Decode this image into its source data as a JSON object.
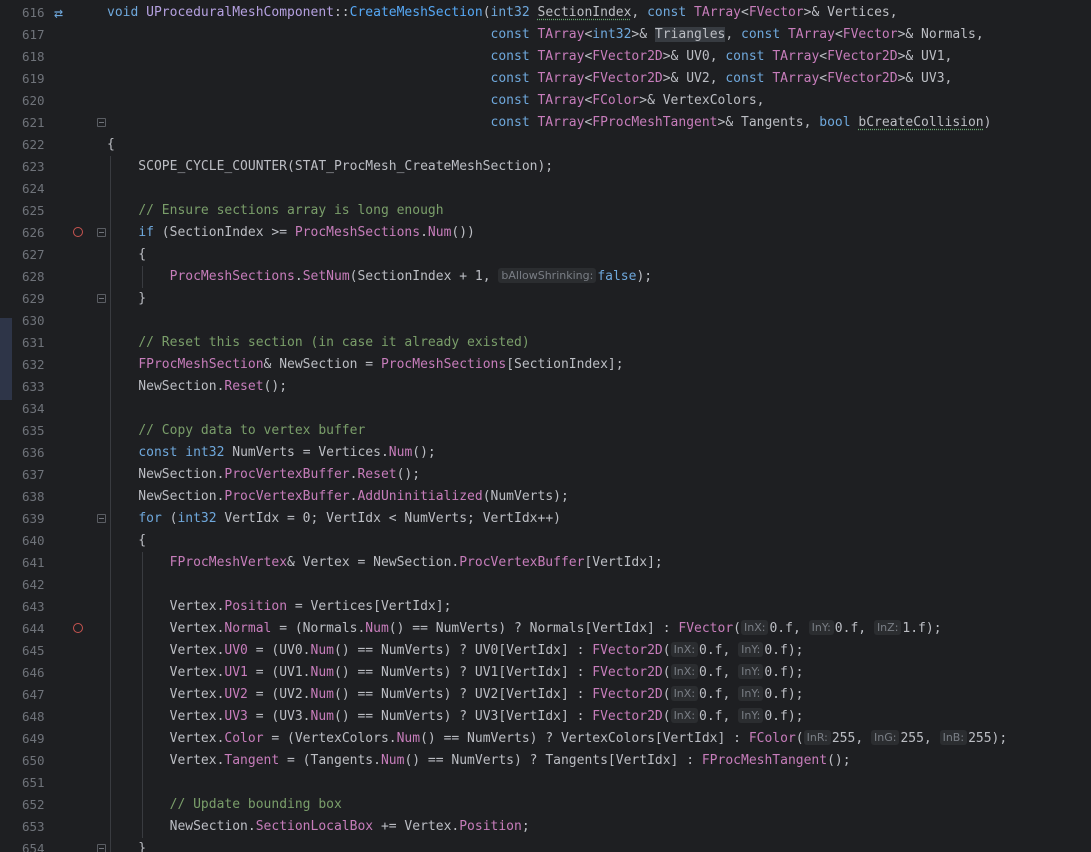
{
  "editor": {
    "lines": [
      {
        "n": "616",
        "icon": "swap",
        "fold": false,
        "bp": false,
        "indent": 0,
        "html": "<span class=\"keyw\">void</span> <span class=\"ty\">UProceduralMeshComponent</span>::<span class=\"fn\">CreateMeshSection</span>(<span class=\"keyw\">int32</span> <span class=\"squig\">SectionIndex</span>, <span class=\"keyw\">const</span> <span class=\"ty2\">TArray</span>&lt;<span class=\"ty2\">FVector</span>&gt;&amp; Vertices,"
      },
      {
        "n": "617",
        "icon": "",
        "fold": false,
        "bp": false,
        "indent": 0,
        "html": "                                                 <span class=\"keyw\">const</span> <span class=\"ty2\">TArray</span>&lt;<span class=\"keyw\">int32</span>&gt;&amp; <span class=\"hl\">Triangles</span>, <span class=\"keyw\">const</span> <span class=\"ty2\">TArray</span>&lt;<span class=\"ty2\">FVector</span>&gt;&amp; Normals,"
      },
      {
        "n": "618",
        "icon": "",
        "fold": false,
        "bp": false,
        "indent": 0,
        "html": "                                                 <span class=\"keyw\">const</span> <span class=\"ty2\">TArray</span>&lt;<span class=\"ty2\">FVector2D</span>&gt;&amp; UV0, <span class=\"keyw\">const</span> <span class=\"ty2\">TArray</span>&lt;<span class=\"ty2\">FVector2D</span>&gt;&amp; UV1,"
      },
      {
        "n": "619",
        "icon": "",
        "fold": false,
        "bp": false,
        "indent": 0,
        "html": "                                                 <span class=\"keyw\">const</span> <span class=\"ty2\">TArray</span>&lt;<span class=\"ty2\">FVector2D</span>&gt;&amp; UV2, <span class=\"keyw\">const</span> <span class=\"ty2\">TArray</span>&lt;<span class=\"ty2\">FVector2D</span>&gt;&amp; UV3,"
      },
      {
        "n": "620",
        "icon": "",
        "fold": false,
        "bp": false,
        "indent": 0,
        "html": "                                                 <span class=\"keyw\">const</span> <span class=\"ty2\">TArray</span>&lt;<span class=\"ty2\">FColor</span>&gt;&amp; VertexColors,"
      },
      {
        "n": "621",
        "icon": "",
        "fold": true,
        "bp": false,
        "indent": 0,
        "html": "                                                 <span class=\"keyw\">const</span> <span class=\"ty2\">TArray</span>&lt;<span class=\"ty2\">FProcMeshTangent</span>&gt;&amp; Tangents, <span class=\"keyw\">bool</span> <span class=\"squig\">bCreateCollision</span>)"
      },
      {
        "n": "622",
        "icon": "",
        "fold": false,
        "bp": false,
        "indent": 0,
        "html": "{"
      },
      {
        "n": "623",
        "icon": "",
        "fold": false,
        "bp": false,
        "indent": 1,
        "html": "    SCOPE_CYCLE_COUNTER(STAT_ProcMesh_CreateMeshSection);"
      },
      {
        "n": "624",
        "icon": "",
        "fold": false,
        "bp": false,
        "indent": 1,
        "html": ""
      },
      {
        "n": "625",
        "icon": "",
        "fold": false,
        "bp": false,
        "indent": 1,
        "html": "    <span class=\"cm\">// Ensure sections array is long enough</span>"
      },
      {
        "n": "626",
        "icon": "",
        "fold": true,
        "bp": true,
        "indent": 1,
        "html": "    <span class=\"keyw\">if</span> (SectionIndex &gt;= <span class=\"fld\">ProcMeshSections</span>.<span class=\"fld\">Num</span>())"
      },
      {
        "n": "627",
        "icon": "",
        "fold": false,
        "bp": false,
        "indent": 1,
        "html": "    {"
      },
      {
        "n": "628",
        "icon": "",
        "fold": false,
        "bp": false,
        "indent": 2,
        "html": "        <span class=\"fld\">ProcMeshSections</span>.<span class=\"fld\">SetNum</span>(SectionIndex + 1, <span class=\"hint\">bAllowShrinking:</span><span class=\"keyw\">false</span>);"
      },
      {
        "n": "629",
        "icon": "",
        "fold": true,
        "bp": false,
        "indent": 1,
        "html": "    }"
      },
      {
        "n": "630",
        "icon": "",
        "fold": false,
        "bp": false,
        "indent": 1,
        "html": ""
      },
      {
        "n": "631",
        "icon": "",
        "fold": false,
        "bp": false,
        "indent": 1,
        "html": "    <span class=\"cm\">// Reset this section (in case it already existed)</span>"
      },
      {
        "n": "632",
        "icon": "",
        "fold": false,
        "bp": false,
        "indent": 1,
        "html": "    <span class=\"fld\">FProcMeshSection</span>&amp; NewSection = <span class=\"fld\">ProcMeshSections</span>[SectionIndex];"
      },
      {
        "n": "633",
        "icon": "",
        "fold": false,
        "bp": false,
        "indent": 1,
        "html": "    NewSection.<span class=\"fld\">Reset</span>();"
      },
      {
        "n": "634",
        "icon": "",
        "fold": false,
        "bp": false,
        "indent": 1,
        "html": ""
      },
      {
        "n": "635",
        "icon": "",
        "fold": false,
        "bp": false,
        "indent": 1,
        "html": "    <span class=\"cm\">// Copy data to vertex buffer</span>"
      },
      {
        "n": "636",
        "icon": "",
        "fold": false,
        "bp": false,
        "indent": 1,
        "html": "    <span class=\"keyw\">const</span> <span class=\"keyw\">int32</span> NumVerts = Vertices.<span class=\"fld\">Num</span>();"
      },
      {
        "n": "637",
        "icon": "",
        "fold": false,
        "bp": false,
        "indent": 1,
        "html": "    NewSection.<span class=\"fld\">ProcVertexBuffer</span>.<span class=\"fld\">Reset</span>();"
      },
      {
        "n": "638",
        "icon": "",
        "fold": false,
        "bp": false,
        "indent": 1,
        "html": "    NewSection.<span class=\"fld\">ProcVertexBuffer</span>.<span class=\"fld\">AddUninitialized</span>(NumVerts);"
      },
      {
        "n": "639",
        "icon": "",
        "fold": true,
        "bp": false,
        "indent": 1,
        "html": "    <span class=\"keyw\">for</span> (<span class=\"keyw\">int32</span> VertIdx = 0; VertIdx &lt; NumVerts; VertIdx++)"
      },
      {
        "n": "640",
        "icon": "",
        "fold": false,
        "bp": false,
        "indent": 1,
        "html": "    {"
      },
      {
        "n": "641",
        "icon": "",
        "fold": false,
        "bp": false,
        "indent": 2,
        "html": "        <span class=\"fld\">FProcMeshVertex</span>&amp; Vertex = NewSection.<span class=\"fld\">ProcVertexBuffer</span>[VertIdx];"
      },
      {
        "n": "642",
        "icon": "",
        "fold": false,
        "bp": false,
        "indent": 2,
        "html": ""
      },
      {
        "n": "643",
        "icon": "",
        "fold": false,
        "bp": false,
        "indent": 2,
        "html": "        Vertex.<span class=\"fld\">Position</span> = Vertices[VertIdx];"
      },
      {
        "n": "644",
        "icon": "",
        "fold": false,
        "bp": true,
        "indent": 2,
        "html": "        Vertex.<span class=\"fld\">Normal</span> = (Normals.<span class=\"fld\">Num</span>() == NumVerts) ? Normals[VertIdx] : <span class=\"fld\">FVector</span>(<span class=\"hint\">InX:</span>0.f, <span class=\"hint\">InY:</span>0.f, <span class=\"hint\">InZ:</span>1.f);"
      },
      {
        "n": "645",
        "icon": "",
        "fold": false,
        "bp": false,
        "indent": 2,
        "html": "        Vertex.<span class=\"fld\">UV0</span> = (UV0.<span class=\"fld\">Num</span>() == NumVerts) ? UV0[VertIdx] : <span class=\"fld\">FVector2D</span>(<span class=\"hint\">InX:</span>0.f, <span class=\"hint\">InY:</span>0.f);"
      },
      {
        "n": "646",
        "icon": "",
        "fold": false,
        "bp": false,
        "indent": 2,
        "html": "        Vertex.<span class=\"fld\">UV1</span> = (UV1.<span class=\"fld\">Num</span>() == NumVerts) ? UV1[VertIdx] : <span class=\"fld\">FVector2D</span>(<span class=\"hint\">InX:</span>0.f, <span class=\"hint\">InY:</span>0.f);"
      },
      {
        "n": "647",
        "icon": "",
        "fold": false,
        "bp": false,
        "indent": 2,
        "html": "        Vertex.<span class=\"fld\">UV2</span> = (UV2.<span class=\"fld\">Num</span>() == NumVerts) ? UV2[VertIdx] : <span class=\"fld\">FVector2D</span>(<span class=\"hint\">InX:</span>0.f, <span class=\"hint\">InY:</span>0.f);"
      },
      {
        "n": "648",
        "icon": "",
        "fold": false,
        "bp": false,
        "indent": 2,
        "html": "        Vertex.<span class=\"fld\">UV3</span> = (UV3.<span class=\"fld\">Num</span>() == NumVerts) ? UV3[VertIdx] : <span class=\"fld\">FVector2D</span>(<span class=\"hint\">InX:</span>0.f, <span class=\"hint\">InY:</span>0.f);"
      },
      {
        "n": "649",
        "icon": "",
        "fold": false,
        "bp": false,
        "indent": 2,
        "html": "        Vertex.<span class=\"fld\">Color</span> = (VertexColors.<span class=\"fld\">Num</span>() == NumVerts) ? VertexColors[VertIdx] : <span class=\"fld\">FColor</span>(<span class=\"hint\">InR:</span>255, <span class=\"hint\">InG:</span>255, <span class=\"hint\">InB:</span>255);"
      },
      {
        "n": "650",
        "icon": "",
        "fold": false,
        "bp": false,
        "indent": 2,
        "html": "        Vertex.<span class=\"fld\">Tangent</span> = (Tangents.<span class=\"fld\">Num</span>() == NumVerts) ? Tangents[VertIdx] : <span class=\"fld\">FProcMeshTangent</span>();"
      },
      {
        "n": "651",
        "icon": "",
        "fold": false,
        "bp": false,
        "indent": 2,
        "html": ""
      },
      {
        "n": "652",
        "icon": "",
        "fold": false,
        "bp": false,
        "indent": 2,
        "html": "        <span class=\"cm\">// Update bounding box</span>"
      },
      {
        "n": "653",
        "icon": "",
        "fold": false,
        "bp": false,
        "indent": 2,
        "html": "        NewSection.<span class=\"fld\">SectionLocalBox</span> += Vertex.<span class=\"fld\">Position</span>;"
      },
      {
        "n": "654",
        "icon": "",
        "fold": true,
        "bp": false,
        "indent": 1,
        "html": "    }"
      }
    ]
  },
  "colors": {
    "background": "#1e1f22",
    "keyword": "#6fa8dc",
    "member": "#c77dbb",
    "comment": "#7a9e6a",
    "breakpoint": "#c75450"
  }
}
